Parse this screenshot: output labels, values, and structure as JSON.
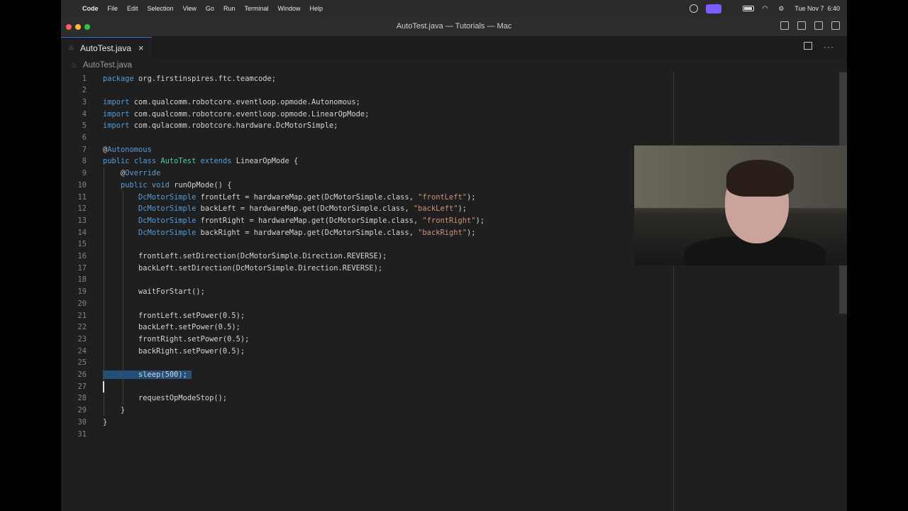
{
  "menubar": {
    "items": [
      "Code",
      "File",
      "Edit",
      "Selection",
      "View",
      "Go",
      "Run",
      "Terminal",
      "Window",
      "Help"
    ],
    "datetime": "Tue Nov 7  6:40"
  },
  "window": {
    "title": "AutoTest.java — Tutorials — Mac"
  },
  "tab": {
    "label": "AutoTest.java",
    "close": "×"
  },
  "breadcrumb": {
    "file": "AutoTest.java"
  },
  "editor": {
    "lines": [
      [
        {
          "t": "package",
          "c": "kw"
        },
        {
          "t": " org.firstinspires.ftc.teamcode;"
        }
      ],
      [],
      [
        {
          "t": "import",
          "c": "kw"
        },
        {
          "t": " com.qualcomm.robotcore.eventloop.opmode.Autonomous;"
        }
      ],
      [
        {
          "t": "import",
          "c": "kw"
        },
        {
          "t": " com.qualcomm.robotcore.eventloop.opmode.LinearOpMode;"
        }
      ],
      [
        {
          "t": "import",
          "c": "kw"
        },
        {
          "t": " com.qulacomm.robotcore.hardware.DcMotorSimple;"
        }
      ],
      [],
      [
        {
          "t": "@",
          "c": "ann"
        },
        {
          "t": "Autonomous",
          "c": "kw"
        }
      ],
      [
        {
          "t": "public",
          "c": "kw"
        },
        {
          "t": " "
        },
        {
          "t": "class",
          "c": "kw"
        },
        {
          "t": " "
        },
        {
          "t": "AutoTest",
          "c": "ty"
        },
        {
          "t": " "
        },
        {
          "t": "extends",
          "c": "kw"
        },
        {
          "t": " LinearOpMode {"
        }
      ],
      [
        {
          "t": "    "
        },
        {
          "t": "@",
          "c": "ann"
        },
        {
          "t": "Override",
          "c": "kw"
        }
      ],
      [
        {
          "t": "    "
        },
        {
          "t": "public",
          "c": "kw"
        },
        {
          "t": " "
        },
        {
          "t": "void",
          "c": "kw"
        },
        {
          "t": " runOpMode() {"
        }
      ],
      [
        {
          "t": "        "
        },
        {
          "t": "DcMotorSimple",
          "c": "kw"
        },
        {
          "t": " frontLeft = hardwareMap.get(DcMotorSimple.class, "
        },
        {
          "t": "\"frontLeft\"",
          "c": "st"
        },
        {
          "t": ");"
        }
      ],
      [
        {
          "t": "        "
        },
        {
          "t": "DcMotorSimple",
          "c": "kw"
        },
        {
          "t": " backLeft = hardwareMap.get(DcMotorSimple.class, "
        },
        {
          "t": "\"backLeft\"",
          "c": "st"
        },
        {
          "t": ");"
        }
      ],
      [
        {
          "t": "        "
        },
        {
          "t": "DcMotorSimple",
          "c": "kw"
        },
        {
          "t": " frontRight = hardwareMap.get(DcMotorSimple.class, "
        },
        {
          "t": "\"frontRight\"",
          "c": "st"
        },
        {
          "t": ");"
        }
      ],
      [
        {
          "t": "        "
        },
        {
          "t": "DcMotorSimple",
          "c": "kw"
        },
        {
          "t": " backRight = hardwareMap.get(DcMotorSimple.class, "
        },
        {
          "t": "\"backRight\"",
          "c": "st"
        },
        {
          "t": ");"
        }
      ],
      [],
      [
        {
          "t": "        frontLeft.setDirection(DcMotorSimple.Direction.REVERSE);"
        }
      ],
      [
        {
          "t": "        backLeft.setDirection(DcMotorSimple.Direction.REVERSE);"
        }
      ],
      [],
      [
        {
          "t": "        waitForStart();"
        }
      ],
      [],
      [
        {
          "t": "        frontLeft.setPower(0.5);"
        }
      ],
      [
        {
          "t": "        backLeft.setPower(0.5);"
        }
      ],
      [
        {
          "t": "        frontRight.setPower(0.5);"
        }
      ],
      [
        {
          "t": "        backRight.setPower(0.5);"
        }
      ],
      [],
      [
        {
          "t": "        sleep(500); ",
          "c": "sel"
        }
      ],
      [],
      [
        {
          "t": "        requestOpModeStop();"
        }
      ],
      [
        {
          "t": "    }"
        }
      ],
      [
        {
          "t": "}"
        }
      ],
      []
    ]
  },
  "colors": {
    "editor_bg": "#1f1f1f",
    "keyword": "#569cd6",
    "type": "#4ec9b0",
    "string": "#ce9178",
    "selection": "#264f78",
    "accent": "#3a7bd5"
  },
  "icons": [
    "apple-icon",
    "java-file-icon",
    "close-icon",
    "split-editor-icon",
    "more-icon",
    "wifi-icon",
    "battery-icon",
    "control-center-icon"
  ]
}
